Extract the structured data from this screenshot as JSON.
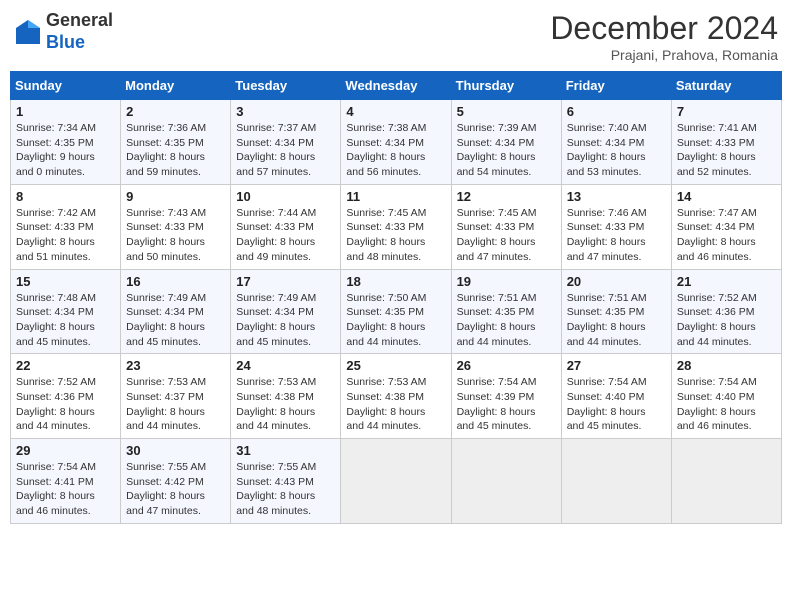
{
  "header": {
    "logo_general": "General",
    "logo_blue": "Blue",
    "month_title": "December 2024",
    "subtitle": "Prajani, Prahova, Romania"
  },
  "columns": [
    "Sunday",
    "Monday",
    "Tuesday",
    "Wednesday",
    "Thursday",
    "Friday",
    "Saturday"
  ],
  "weeks": [
    [
      {
        "day": "1",
        "sunrise": "7:34 AM",
        "sunset": "4:35 PM",
        "daylight": "9 hours and 0 minutes."
      },
      {
        "day": "2",
        "sunrise": "7:36 AM",
        "sunset": "4:35 PM",
        "daylight": "8 hours and 59 minutes."
      },
      {
        "day": "3",
        "sunrise": "7:37 AM",
        "sunset": "4:34 PM",
        "daylight": "8 hours and 57 minutes."
      },
      {
        "day": "4",
        "sunrise": "7:38 AM",
        "sunset": "4:34 PM",
        "daylight": "8 hours and 56 minutes."
      },
      {
        "day": "5",
        "sunrise": "7:39 AM",
        "sunset": "4:34 PM",
        "daylight": "8 hours and 54 minutes."
      },
      {
        "day": "6",
        "sunrise": "7:40 AM",
        "sunset": "4:34 PM",
        "daylight": "8 hours and 53 minutes."
      },
      {
        "day": "7",
        "sunrise": "7:41 AM",
        "sunset": "4:33 PM",
        "daylight": "8 hours and 52 minutes."
      }
    ],
    [
      {
        "day": "8",
        "sunrise": "7:42 AM",
        "sunset": "4:33 PM",
        "daylight": "8 hours and 51 minutes."
      },
      {
        "day": "9",
        "sunrise": "7:43 AM",
        "sunset": "4:33 PM",
        "daylight": "8 hours and 50 minutes."
      },
      {
        "day": "10",
        "sunrise": "7:44 AM",
        "sunset": "4:33 PM",
        "daylight": "8 hours and 49 minutes."
      },
      {
        "day": "11",
        "sunrise": "7:45 AM",
        "sunset": "4:33 PM",
        "daylight": "8 hours and 48 minutes."
      },
      {
        "day": "12",
        "sunrise": "7:45 AM",
        "sunset": "4:33 PM",
        "daylight": "8 hours and 47 minutes."
      },
      {
        "day": "13",
        "sunrise": "7:46 AM",
        "sunset": "4:33 PM",
        "daylight": "8 hours and 47 minutes."
      },
      {
        "day": "14",
        "sunrise": "7:47 AM",
        "sunset": "4:34 PM",
        "daylight": "8 hours and 46 minutes."
      }
    ],
    [
      {
        "day": "15",
        "sunrise": "7:48 AM",
        "sunset": "4:34 PM",
        "daylight": "8 hours and 45 minutes."
      },
      {
        "day": "16",
        "sunrise": "7:49 AM",
        "sunset": "4:34 PM",
        "daylight": "8 hours and 45 minutes."
      },
      {
        "day": "17",
        "sunrise": "7:49 AM",
        "sunset": "4:34 PM",
        "daylight": "8 hours and 45 minutes."
      },
      {
        "day": "18",
        "sunrise": "7:50 AM",
        "sunset": "4:35 PM",
        "daylight": "8 hours and 44 minutes."
      },
      {
        "day": "19",
        "sunrise": "7:51 AM",
        "sunset": "4:35 PM",
        "daylight": "8 hours and 44 minutes."
      },
      {
        "day": "20",
        "sunrise": "7:51 AM",
        "sunset": "4:35 PM",
        "daylight": "8 hours and 44 minutes."
      },
      {
        "day": "21",
        "sunrise": "7:52 AM",
        "sunset": "4:36 PM",
        "daylight": "8 hours and 44 minutes."
      }
    ],
    [
      {
        "day": "22",
        "sunrise": "7:52 AM",
        "sunset": "4:36 PM",
        "daylight": "8 hours and 44 minutes."
      },
      {
        "day": "23",
        "sunrise": "7:53 AM",
        "sunset": "4:37 PM",
        "daylight": "8 hours and 44 minutes."
      },
      {
        "day": "24",
        "sunrise": "7:53 AM",
        "sunset": "4:38 PM",
        "daylight": "8 hours and 44 minutes."
      },
      {
        "day": "25",
        "sunrise": "7:53 AM",
        "sunset": "4:38 PM",
        "daylight": "8 hours and 44 minutes."
      },
      {
        "day": "26",
        "sunrise": "7:54 AM",
        "sunset": "4:39 PM",
        "daylight": "8 hours and 45 minutes."
      },
      {
        "day": "27",
        "sunrise": "7:54 AM",
        "sunset": "4:40 PM",
        "daylight": "8 hours and 45 minutes."
      },
      {
        "day": "28",
        "sunrise": "7:54 AM",
        "sunset": "4:40 PM",
        "daylight": "8 hours and 46 minutes."
      }
    ],
    [
      {
        "day": "29",
        "sunrise": "7:54 AM",
        "sunset": "4:41 PM",
        "daylight": "8 hours and 46 minutes."
      },
      {
        "day": "30",
        "sunrise": "7:55 AM",
        "sunset": "4:42 PM",
        "daylight": "8 hours and 47 minutes."
      },
      {
        "day": "31",
        "sunrise": "7:55 AM",
        "sunset": "4:43 PM",
        "daylight": "8 hours and 48 minutes."
      },
      null,
      null,
      null,
      null
    ]
  ]
}
